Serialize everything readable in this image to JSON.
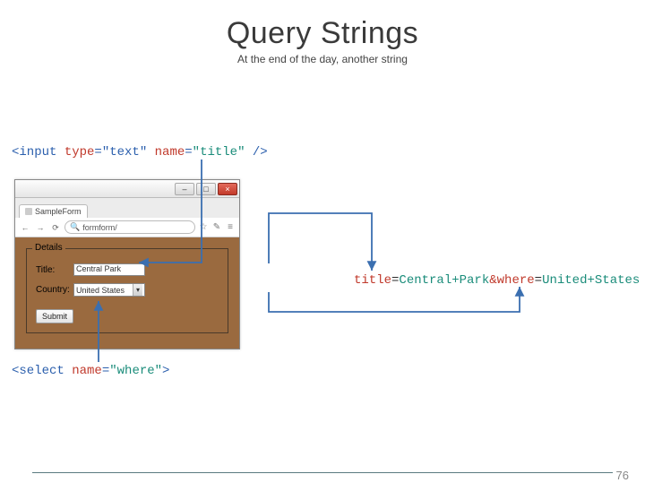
{
  "title": "Query Strings",
  "subtitle": "At the end of the day, another string",
  "code_top": {
    "p1": "<input ",
    "p2": "type",
    "p3": "=",
    "p4": "\"text\"",
    "p5": " ",
    "p6": "name",
    "p7": "=",
    "p8": "\"title\"",
    "p9": " />"
  },
  "code_bottom": {
    "p1": "<select ",
    "p2": "name",
    "p3": "=",
    "p4": "\"where\"",
    "p5": ">"
  },
  "code_right": {
    "p1": "title",
    "p2": "=",
    "p3": "Central+Park",
    "p4": "&",
    "p5": "where",
    "p6": "=",
    "p7": "United+States"
  },
  "browser": {
    "tab_label": "SampleForm",
    "url_text": "formform/",
    "win_min": "–",
    "win_max": "□",
    "win_close": "×",
    "back": "←",
    "fwd": "→",
    "reload": "⟳",
    "star": "☆",
    "wrench": "✎",
    "menu": "≡"
  },
  "form": {
    "legend": "Details",
    "title_label": "Title:",
    "title_value": "Central Park",
    "country_label": "Country:",
    "country_value": "United States",
    "submit": "Submit"
  },
  "page_number": "76"
}
